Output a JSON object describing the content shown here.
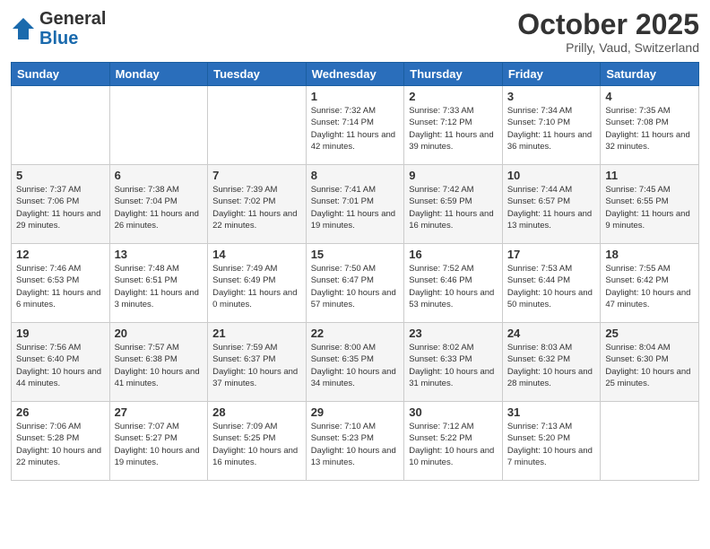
{
  "header": {
    "logo_general": "General",
    "logo_blue": "Blue",
    "month_title": "October 2025",
    "location": "Prilly, Vaud, Switzerland"
  },
  "days_of_week": [
    "Sunday",
    "Monday",
    "Tuesday",
    "Wednesday",
    "Thursday",
    "Friday",
    "Saturday"
  ],
  "weeks": [
    [
      null,
      null,
      null,
      {
        "day": 1,
        "sunrise": "7:32 AM",
        "sunset": "7:14 PM",
        "daylight": "11 hours and 42 minutes."
      },
      {
        "day": 2,
        "sunrise": "7:33 AM",
        "sunset": "7:12 PM",
        "daylight": "11 hours and 39 minutes."
      },
      {
        "day": 3,
        "sunrise": "7:34 AM",
        "sunset": "7:10 PM",
        "daylight": "11 hours and 36 minutes."
      },
      {
        "day": 4,
        "sunrise": "7:35 AM",
        "sunset": "7:08 PM",
        "daylight": "11 hours and 32 minutes."
      }
    ],
    [
      {
        "day": 5,
        "sunrise": "7:37 AM",
        "sunset": "7:06 PM",
        "daylight": "11 hours and 29 minutes."
      },
      {
        "day": 6,
        "sunrise": "7:38 AM",
        "sunset": "7:04 PM",
        "daylight": "11 hours and 26 minutes."
      },
      {
        "day": 7,
        "sunrise": "7:39 AM",
        "sunset": "7:02 PM",
        "daylight": "11 hours and 22 minutes."
      },
      {
        "day": 8,
        "sunrise": "7:41 AM",
        "sunset": "7:01 PM",
        "daylight": "11 hours and 19 minutes."
      },
      {
        "day": 9,
        "sunrise": "7:42 AM",
        "sunset": "6:59 PM",
        "daylight": "11 hours and 16 minutes."
      },
      {
        "day": 10,
        "sunrise": "7:44 AM",
        "sunset": "6:57 PM",
        "daylight": "11 hours and 13 minutes."
      },
      {
        "day": 11,
        "sunrise": "7:45 AM",
        "sunset": "6:55 PM",
        "daylight": "11 hours and 9 minutes."
      }
    ],
    [
      {
        "day": 12,
        "sunrise": "7:46 AM",
        "sunset": "6:53 PM",
        "daylight": "11 hours and 6 minutes."
      },
      {
        "day": 13,
        "sunrise": "7:48 AM",
        "sunset": "6:51 PM",
        "daylight": "11 hours and 3 minutes."
      },
      {
        "day": 14,
        "sunrise": "7:49 AM",
        "sunset": "6:49 PM",
        "daylight": "11 hours and 0 minutes."
      },
      {
        "day": 15,
        "sunrise": "7:50 AM",
        "sunset": "6:47 PM",
        "daylight": "10 hours and 57 minutes."
      },
      {
        "day": 16,
        "sunrise": "7:52 AM",
        "sunset": "6:46 PM",
        "daylight": "10 hours and 53 minutes."
      },
      {
        "day": 17,
        "sunrise": "7:53 AM",
        "sunset": "6:44 PM",
        "daylight": "10 hours and 50 minutes."
      },
      {
        "day": 18,
        "sunrise": "7:55 AM",
        "sunset": "6:42 PM",
        "daylight": "10 hours and 47 minutes."
      }
    ],
    [
      {
        "day": 19,
        "sunrise": "7:56 AM",
        "sunset": "6:40 PM",
        "daylight": "10 hours and 44 minutes."
      },
      {
        "day": 20,
        "sunrise": "7:57 AM",
        "sunset": "6:38 PM",
        "daylight": "10 hours and 41 minutes."
      },
      {
        "day": 21,
        "sunrise": "7:59 AM",
        "sunset": "6:37 PM",
        "daylight": "10 hours and 37 minutes."
      },
      {
        "day": 22,
        "sunrise": "8:00 AM",
        "sunset": "6:35 PM",
        "daylight": "10 hours and 34 minutes."
      },
      {
        "day": 23,
        "sunrise": "8:02 AM",
        "sunset": "6:33 PM",
        "daylight": "10 hours and 31 minutes."
      },
      {
        "day": 24,
        "sunrise": "8:03 AM",
        "sunset": "6:32 PM",
        "daylight": "10 hours and 28 minutes."
      },
      {
        "day": 25,
        "sunrise": "8:04 AM",
        "sunset": "6:30 PM",
        "daylight": "10 hours and 25 minutes."
      }
    ],
    [
      {
        "day": 26,
        "sunrise": "7:06 AM",
        "sunset": "5:28 PM",
        "daylight": "10 hours and 22 minutes."
      },
      {
        "day": 27,
        "sunrise": "7:07 AM",
        "sunset": "5:27 PM",
        "daylight": "10 hours and 19 minutes."
      },
      {
        "day": 28,
        "sunrise": "7:09 AM",
        "sunset": "5:25 PM",
        "daylight": "10 hours and 16 minutes."
      },
      {
        "day": 29,
        "sunrise": "7:10 AM",
        "sunset": "5:23 PM",
        "daylight": "10 hours and 13 minutes."
      },
      {
        "day": 30,
        "sunrise": "7:12 AM",
        "sunset": "5:22 PM",
        "daylight": "10 hours and 10 minutes."
      },
      {
        "day": 31,
        "sunrise": "7:13 AM",
        "sunset": "5:20 PM",
        "daylight": "10 hours and 7 minutes."
      },
      null
    ]
  ]
}
